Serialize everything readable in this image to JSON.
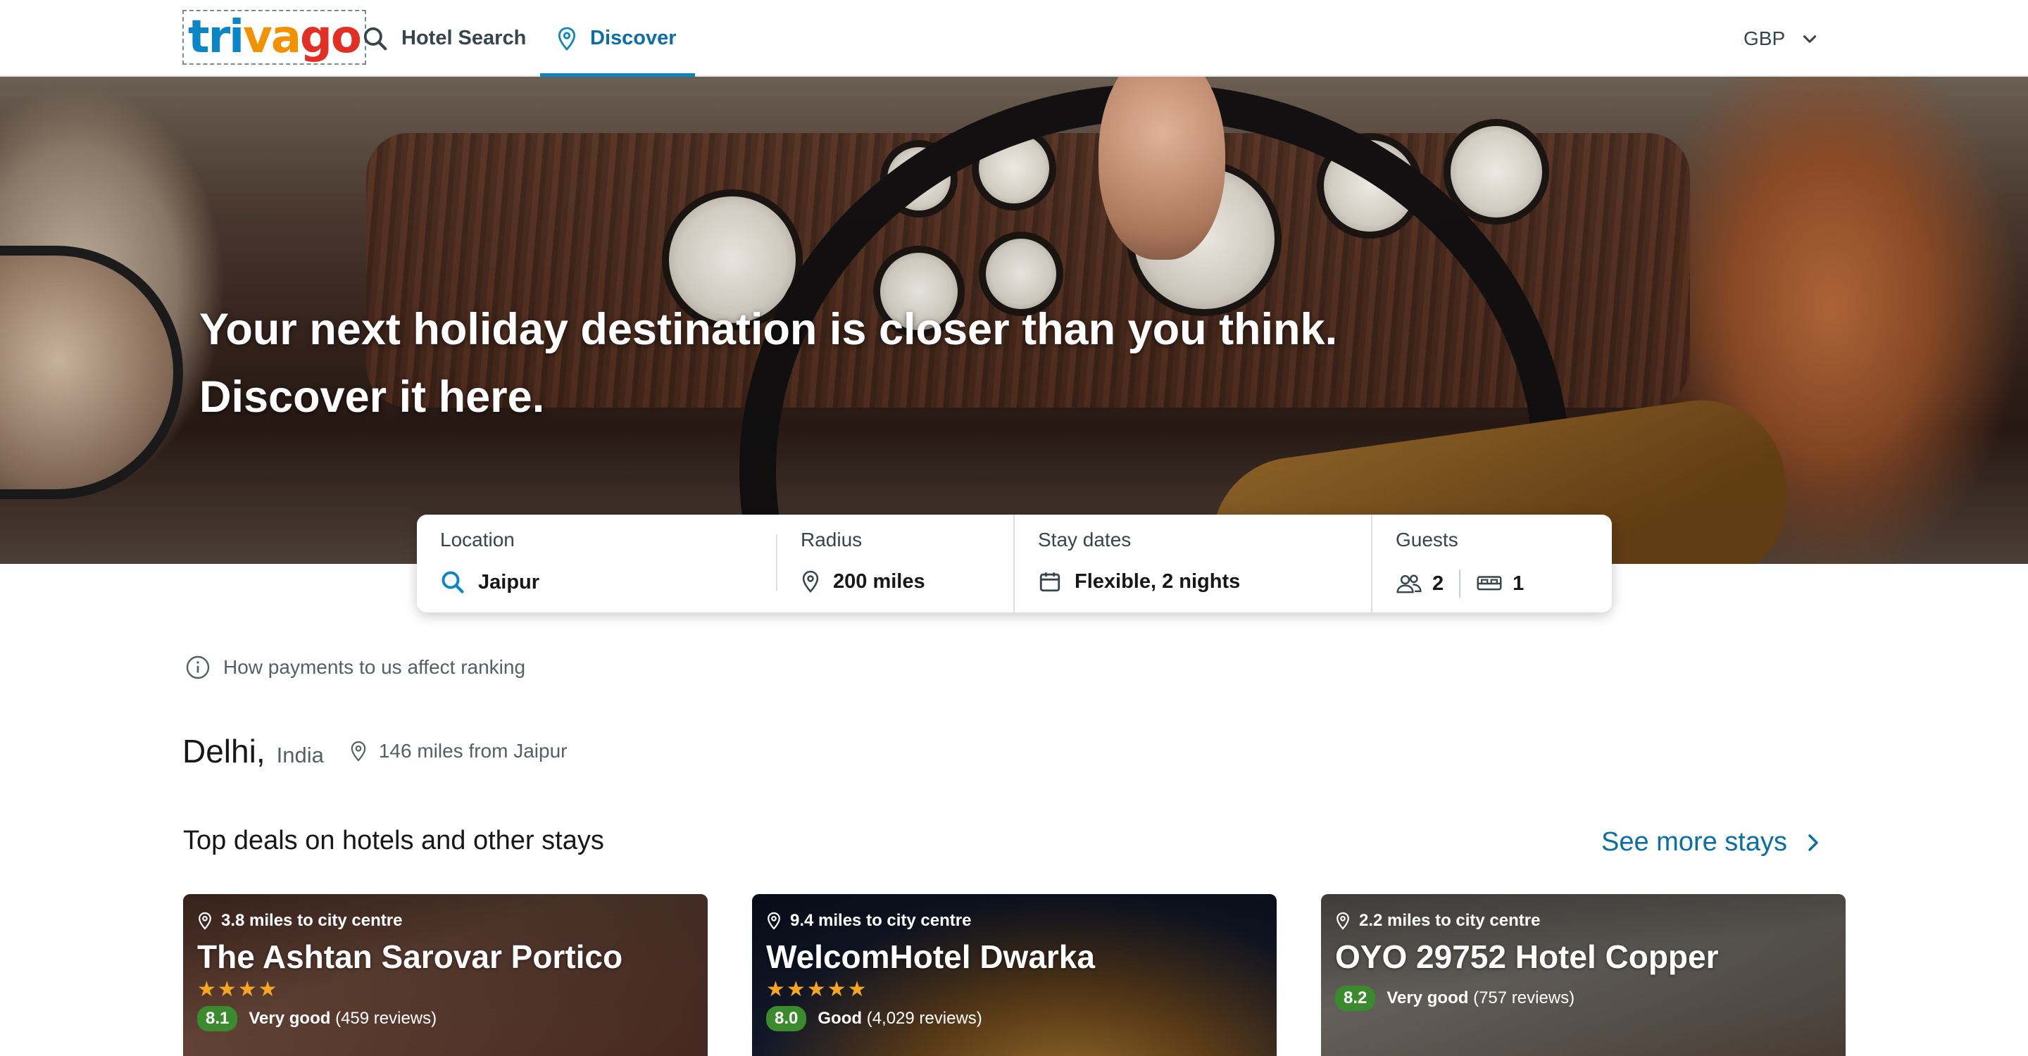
{
  "header": {
    "logo": [
      "tri",
      "va",
      "go"
    ],
    "nav": [
      {
        "label": "Hotel Search",
        "icon": "search-icon"
      },
      {
        "label": "Discover",
        "icon": "map-pin-icon",
        "active": true
      }
    ],
    "currency": "GBP"
  },
  "hero": {
    "headline_line1": "Your next holiday destination is closer than you think.",
    "headline_line2": "Discover it here."
  },
  "search": {
    "location_label": "Location",
    "location_value": "Jaipur",
    "radius_label": "Radius",
    "radius_value": "200 miles",
    "dates_label": "Stay dates",
    "dates_value": "Flexible, 2 nights",
    "guests_label": "Guests",
    "guests_value": "2",
    "rooms_value": "1"
  },
  "ranking_info": "How payments to us affect ranking",
  "destination": {
    "city": "Delhi,",
    "country": "India",
    "distance": "146 miles from Jaipur"
  },
  "deals": {
    "title": "Top deals on hotels and other stays",
    "see_more": "See more stays",
    "cards": [
      {
        "distance": "3.8 miles to city centre",
        "name": "The Ashtan Sarovar Portico",
        "stars": "★★★★",
        "score": "8.1",
        "rating": "Very good",
        "reviews": "(459 reviews)"
      },
      {
        "distance": "9.4 miles to city centre",
        "name": "WelcomHotel Dwarka",
        "stars": "★★★★★",
        "score": "8.0",
        "rating": "Good",
        "reviews": "(4,029 reviews)"
      },
      {
        "distance": "2.2 miles to city centre",
        "name": "OYO 29752 Hotel Copper",
        "stars": "",
        "score": "8.2",
        "rating": "Very good",
        "reviews": "(757 reviews)"
      }
    ]
  },
  "colors": {
    "brand_blue": "#0a86c6",
    "link_blue": "#0a6ea8",
    "rating_green": "#3b8a2e",
    "star": "#f6a623"
  }
}
